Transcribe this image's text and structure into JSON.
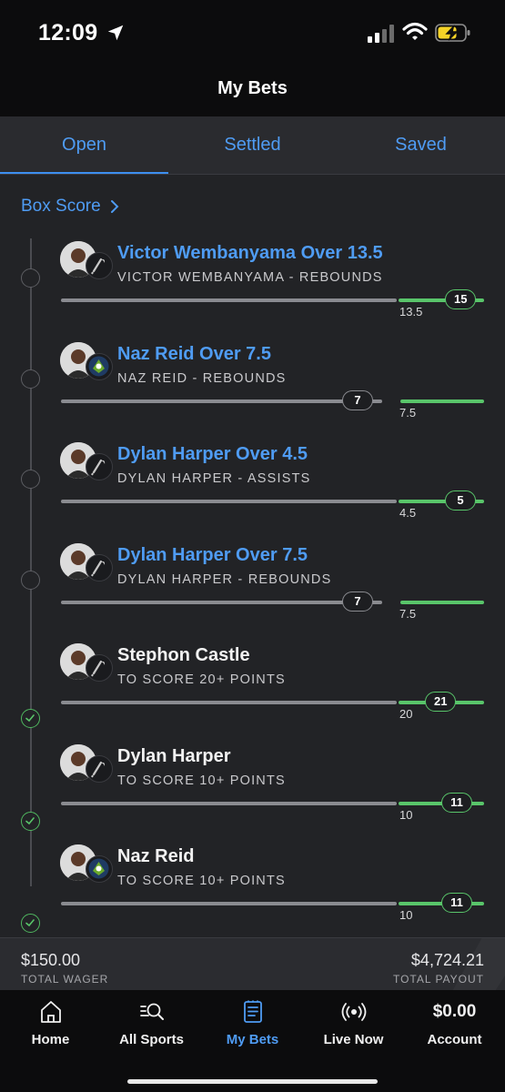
{
  "status_bar": {
    "time": "12:09"
  },
  "header": {
    "title": "My Bets"
  },
  "tabs": [
    {
      "label": "Open",
      "active": true
    },
    {
      "label": "Settled",
      "active": false
    },
    {
      "label": "Saved",
      "active": false
    }
  ],
  "box_score": {
    "label": "Box Score"
  },
  "legs": [
    {
      "title": "Victor Wembanyama Over 13.5",
      "subtitle": "VICTOR WEMBANYAMA - REBOUNDS",
      "target": "13.5",
      "current": "15",
      "status": "open",
      "team": "Spurs",
      "progress": 1.11
    },
    {
      "title": "Naz Reid Over 7.5",
      "subtitle": "NAZ REID - REBOUNDS",
      "target": "7.5",
      "current": "7",
      "status": "open",
      "team": "Timberwolves",
      "progress": 0.93
    },
    {
      "title": "Dylan Harper Over 4.5",
      "subtitle": "DYLAN HARPER - ASSISTS",
      "target": "4.5",
      "current": "5",
      "status": "open",
      "team": "Spurs",
      "progress": 1.11
    },
    {
      "title": "Dylan Harper Over 7.5",
      "subtitle": "DYLAN HARPER - REBOUNDS",
      "target": "7.5",
      "current": "7",
      "status": "open",
      "team": "Spurs",
      "progress": 0.93
    },
    {
      "title": "Stephon Castle",
      "subtitle": "TO SCORE 20+ POINTS",
      "target": "20",
      "current": "21",
      "status": "won",
      "team": "Spurs",
      "progress": 1.05
    },
    {
      "title": "Dylan Harper",
      "subtitle": "TO SCORE 10+ POINTS",
      "target": "10",
      "current": "11",
      "status": "won",
      "team": "Spurs",
      "progress": 1.1
    },
    {
      "title": "Naz Reid",
      "subtitle": "TO SCORE 10+ POINTS",
      "target": "10",
      "current": "11",
      "status": "won",
      "team": "Timberwolves",
      "progress": 1.1
    }
  ],
  "summary": {
    "wager_amount": "$150.00",
    "wager_label": "TOTAL WAGER",
    "payout_amount": "$4,724.21",
    "payout_label": "TOTAL PAYOUT"
  },
  "bottom_nav": [
    {
      "label": "Home",
      "icon": "home-icon",
      "active": false
    },
    {
      "label": "All Sports",
      "icon": "search-list-icon",
      "active": false
    },
    {
      "label": "My Bets",
      "icon": "bet-slip-icon",
      "active": true
    },
    {
      "label": "Live Now",
      "icon": "broadcast-icon",
      "active": false
    },
    {
      "label": "Account",
      "balance": "$0.00",
      "active": false
    }
  ],
  "colors": {
    "accent": "#4f9cf4",
    "win": "#59c56a",
    "track": "#8a8b90",
    "background": "#222326"
  }
}
